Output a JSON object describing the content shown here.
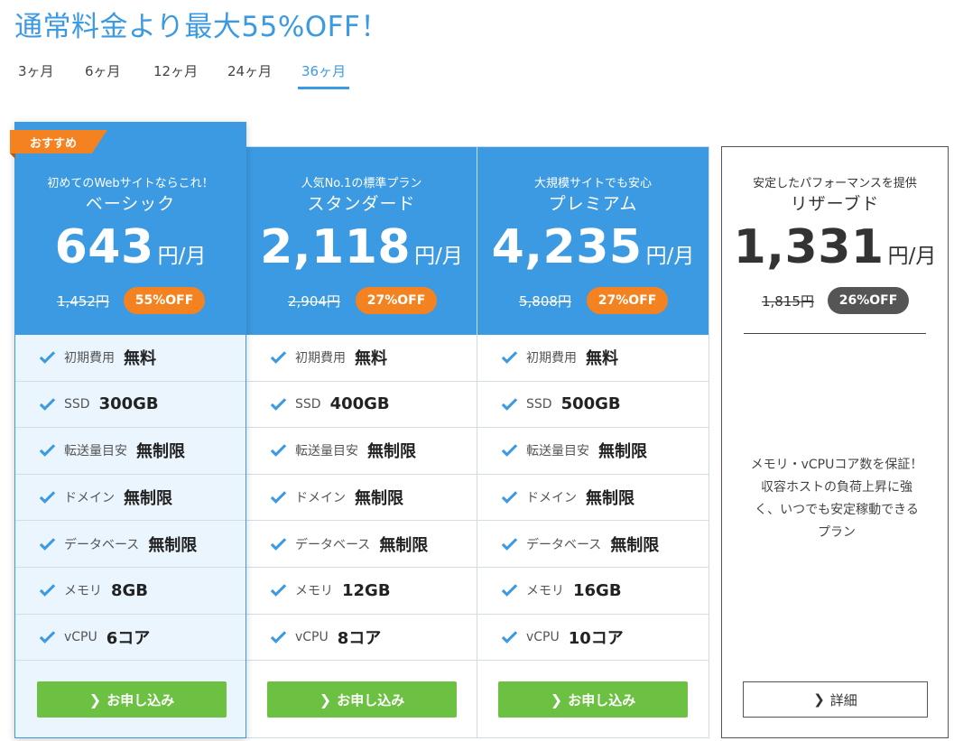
{
  "headline": "通常料金より最大55%OFF！",
  "tabs": [
    {
      "label": "3ヶ月",
      "active": false
    },
    {
      "label": "6ヶ月",
      "active": false
    },
    {
      "label": "12ヶ月",
      "active": false
    },
    {
      "label": "24ヶ月",
      "active": false
    },
    {
      "label": "36ヶ月",
      "active": true
    }
  ],
  "colors": {
    "accent": "#3b9ae1",
    "ribbon": "#f58220",
    "button": "#6cc143",
    "reserved_badge": "#555555"
  },
  "plans": [
    {
      "ribbon": "おすすめ",
      "tagline": "初めてのWebサイトならこれ！",
      "name": "ベーシック",
      "price": "643",
      "unit": "円/月",
      "original": "1,452円",
      "discount": "55%OFF",
      "features": [
        {
          "label": "初期費用",
          "value": "無料"
        },
        {
          "label": "SSD",
          "value": "300GB"
        },
        {
          "label": "転送量目安",
          "value": "無制限"
        },
        {
          "label": "ドメイン",
          "value": "無制限"
        },
        {
          "label": "データベース",
          "value": "無制限"
        },
        {
          "label": "メモリ",
          "value": "8GB"
        },
        {
          "label": "vCPU",
          "value": "6コア"
        }
      ],
      "cta": "お申し込み"
    },
    {
      "tagline": "人気No.1の標準プラン",
      "name": "スタンダード",
      "price": "2,118",
      "unit": "円/月",
      "original": "2,904円",
      "discount": "27%OFF",
      "features": [
        {
          "label": "初期費用",
          "value": "無料"
        },
        {
          "label": "SSD",
          "value": "400GB"
        },
        {
          "label": "転送量目安",
          "value": "無制限"
        },
        {
          "label": "ドメイン",
          "value": "無制限"
        },
        {
          "label": "データベース",
          "value": "無制限"
        },
        {
          "label": "メモリ",
          "value": "12GB"
        },
        {
          "label": "vCPU",
          "value": "8コア"
        }
      ],
      "cta": "お申し込み"
    },
    {
      "tagline": "大規模サイトでも安心",
      "name": "プレミアム",
      "price": "4,235",
      "unit": "円/月",
      "original": "5,808円",
      "discount": "27%OFF",
      "features": [
        {
          "label": "初期費用",
          "value": "無料"
        },
        {
          "label": "SSD",
          "value": "500GB"
        },
        {
          "label": "転送量目安",
          "value": "無制限"
        },
        {
          "label": "ドメイン",
          "value": "無制限"
        },
        {
          "label": "データベース",
          "value": "無制限"
        },
        {
          "label": "メモリ",
          "value": "16GB"
        },
        {
          "label": "vCPU",
          "value": "10コア"
        }
      ],
      "cta": "お申し込み"
    }
  ],
  "reserved": {
    "tagline": "安定したパフォーマンスを提供",
    "name": "リザーブド",
    "price": "1,331",
    "unit": "円/月",
    "original": "1,815円",
    "discount": "26%OFF",
    "description": "メモリ・vCPUコア数を保証！収容ホストの負荷上昇に強く、いつでも安定稼動できるプラン",
    "cta": "詳細"
  },
  "icons": {
    "check": "check-icon",
    "chevron": "chevron-right-icon"
  }
}
